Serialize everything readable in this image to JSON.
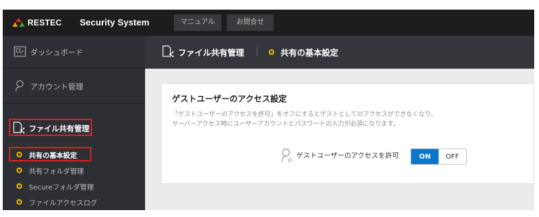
{
  "topbar": {
    "logo_text": "RESTEC",
    "app_title": "Security System",
    "buttons": [
      "マニュアル",
      "お問合せ"
    ]
  },
  "sidebar": {
    "items": [
      {
        "label": "ダッシュボード",
        "icon": "dashboard-icon"
      },
      {
        "label": "アカウント管理",
        "icon": "account-icon"
      },
      {
        "label": "ファイル共有管理",
        "icon": "file-share-icon"
      }
    ],
    "sub_items": [
      {
        "label": "共有の基本設定",
        "active": true
      },
      {
        "label": "共有フォルダ管理",
        "active": false
      },
      {
        "label": "Secureフォルダ管理",
        "active": false
      },
      {
        "label": "ファイルアクセスログ",
        "active": false
      }
    ]
  },
  "header": {
    "section": "ファイル共有管理",
    "separator": "|",
    "current": "共有の基本設定"
  },
  "card": {
    "title": "ゲストユーザーのアクセス設定",
    "description_lines": [
      "「ゲストユーザーのアクセスを許可」をオフにするとゲストとしてのアクセスができなくなり、",
      "サーバーアクセス時にユーザーアカウントとパスワードの入力が必須になります。"
    ],
    "toggle_label": "ゲストユーザーのアクセスを許可",
    "toggle": {
      "on_label": "ON",
      "off_label": "OFF",
      "value": "ON"
    }
  },
  "colors": {
    "topbar_bg": "#1d1d1f",
    "sidebar_bg": "#2e2f34",
    "header_bg": "#34363b",
    "accent_yellow": "#f2c200",
    "highlight_red": "#e02020",
    "toggle_on": "#0a78c8"
  }
}
